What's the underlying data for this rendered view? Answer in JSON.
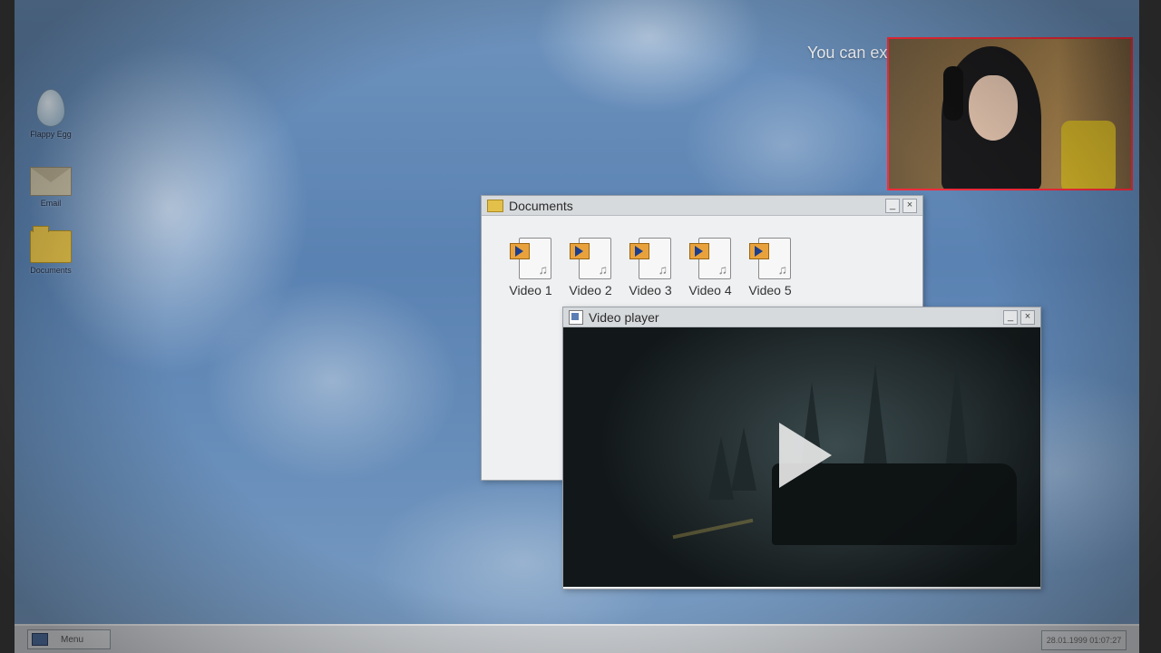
{
  "overlay_text": "You can exi",
  "desktop_icons": [
    {
      "label": "Flappy Egg",
      "icon": "egg-icon"
    },
    {
      "label": "Email",
      "icon": "envelope-icon"
    },
    {
      "label": "Documents",
      "icon": "folder-icon"
    }
  ],
  "documents_window": {
    "title": "Documents",
    "minimize": "_",
    "close": "×",
    "files": [
      {
        "label": "Video 1",
        "icon": "video-file-icon"
      },
      {
        "label": "Video 2",
        "icon": "video-file-icon"
      },
      {
        "label": "Video 3",
        "icon": "video-file-icon"
      },
      {
        "label": "Video 4",
        "icon": "video-file-icon"
      },
      {
        "label": "Video 5",
        "icon": "video-file-icon"
      }
    ]
  },
  "video_player": {
    "title": "Video player",
    "minimize": "_",
    "close": "×",
    "play_icon": "play-icon"
  },
  "taskbar": {
    "menu_label": "Menu",
    "clock": "28.01.1999 01:07:27"
  },
  "colors": {
    "webcam_border": "#ff2b3c",
    "folder": "#e3c04a"
  }
}
